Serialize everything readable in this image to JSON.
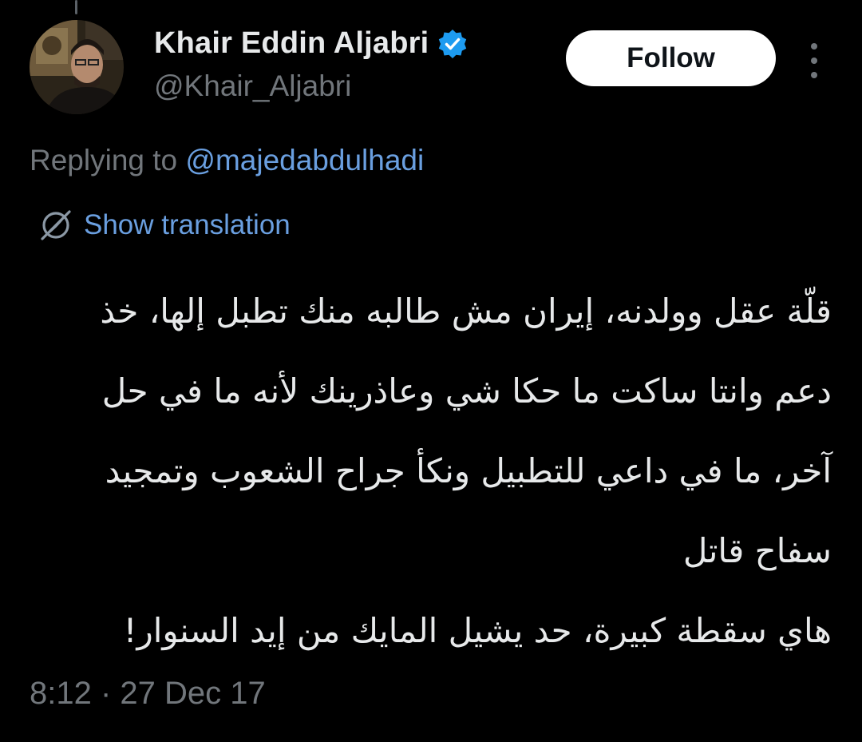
{
  "author": {
    "display_name": "Khair Eddin Aljabri",
    "handle": "@Khair_Aljabri",
    "verified": true
  },
  "actions": {
    "follow_label": "Follow"
  },
  "reply": {
    "prefix": "Replying to ",
    "mention": "@majedabdulhadi"
  },
  "translation": {
    "label": "Show translation",
    "icon": "globe-translate-icon"
  },
  "tweet": {
    "lines": [
      "قلّة عقل وولدنه، إيران مش طالبه منك تطبل إلها، خذ",
      "دعم وانتا ساكت ما حكا شي وعاذرينك لأنه ما في حل",
      "آخر، ما في داعي للتطبيل ونكأ جراح الشعوب وتمجيد",
      "سفاح قاتل",
      "هاي سقطة كبيرة، حد يشيل المايك من إيد السنوار!"
    ]
  },
  "meta": {
    "timestamp": "8:12 · 27 Dec 17"
  },
  "colors": {
    "background": "#000000",
    "text": "#e7e9ea",
    "muted": "#71767b",
    "link": "#6a9fe0",
    "verified": "#1d9bf0"
  }
}
